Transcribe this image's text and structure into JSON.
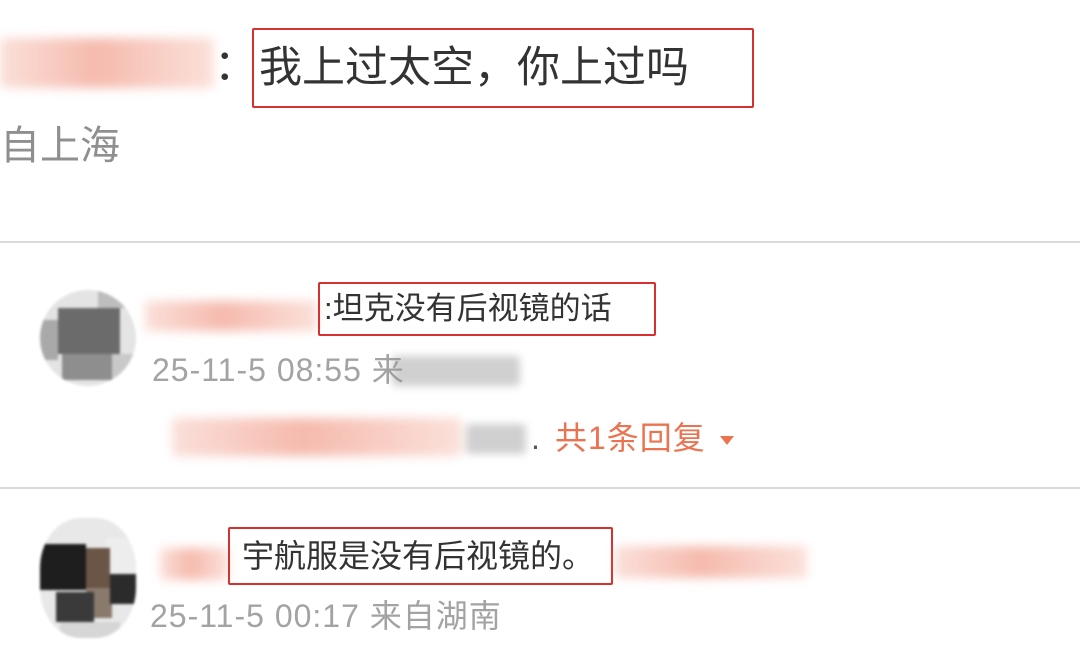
{
  "colors": {
    "background": "#ffffff",
    "text": "#333333",
    "meta": "#a3a3a3",
    "location_faded": "#8f8f8f",
    "link": "#eb7350",
    "annotation_box": "#d6302f",
    "divider": "#d9d9d9"
  },
  "top_comment": {
    "separator": "：",
    "text": "我上过太空，你上过吗",
    "location_fragment": "自上海"
  },
  "comments": [
    {
      "text": ":坦克没有后视镜的话",
      "meta": "25-11-5 08:55 来",
      "replies": {
        "separator": ".",
        "count_label": "共1条回复",
        "toggle_icon": "caret-down-icon"
      }
    },
    {
      "text": "宇航服是没有后视镜的。",
      "meta": "25-11-5 00:17 来自湖南"
    }
  ]
}
